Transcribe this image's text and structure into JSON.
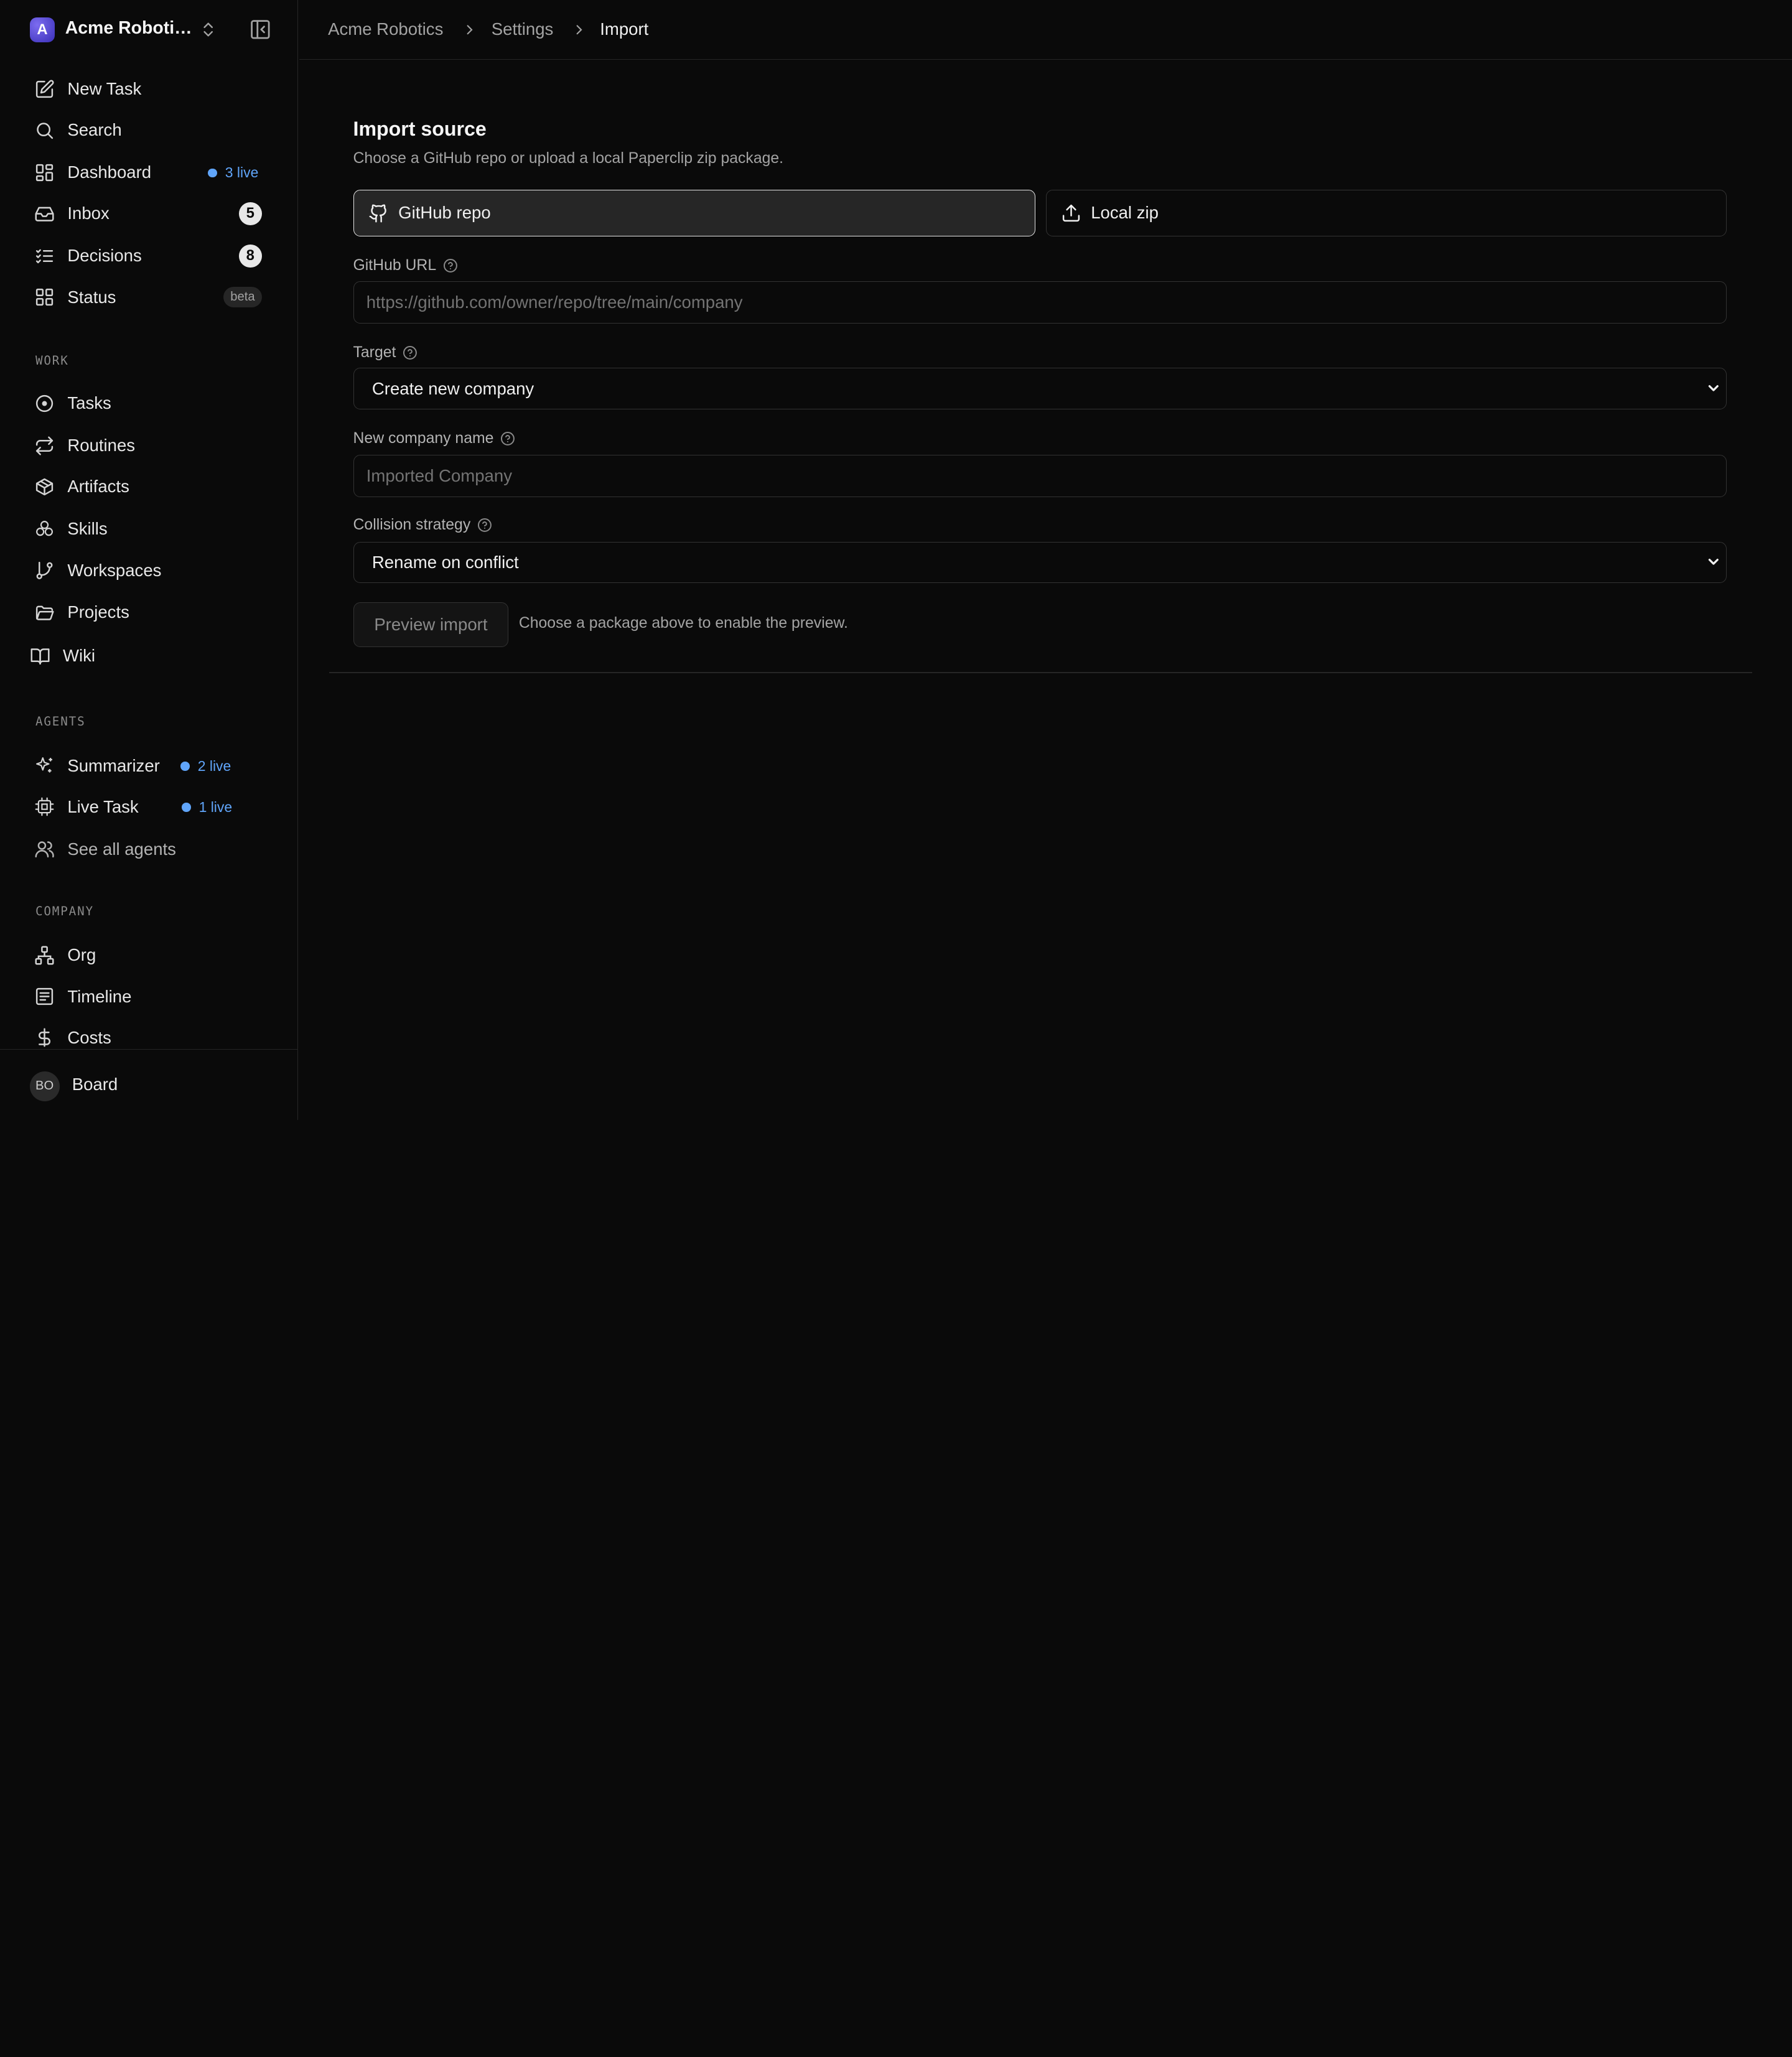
{
  "sidebar": {
    "company": {
      "initial": "A",
      "name": "Acme Robotics"
    },
    "primary": [
      {
        "label": "New Task"
      },
      {
        "label": "Search"
      },
      {
        "label": "Dashboard",
        "live": "3 live"
      },
      {
        "label": "Inbox",
        "count": "5"
      },
      {
        "label": "Decisions",
        "count": "8"
      },
      {
        "label": "Status",
        "badge": "beta"
      }
    ],
    "work": {
      "title": "WORK",
      "items": [
        {
          "label": "Tasks"
        },
        {
          "label": "Routines"
        },
        {
          "label": "Artifacts"
        },
        {
          "label": "Skills"
        },
        {
          "label": "Workspaces"
        },
        {
          "label": "Projects"
        },
        {
          "label": "Wiki"
        }
      ]
    },
    "agents": {
      "title": "AGENTS",
      "items": [
        {
          "label": "Summarizer",
          "live": "2 live"
        },
        {
          "label": "Live Task",
          "live": "1 live"
        },
        {
          "label": "See all agents"
        }
      ]
    },
    "company_section": {
      "title": "COMPANY",
      "items": [
        {
          "label": "Org"
        },
        {
          "label": "Timeline"
        },
        {
          "label": "Costs"
        }
      ]
    },
    "user": {
      "initials": "BO",
      "name": "Board"
    }
  },
  "breadcrumb": [
    "Acme Robotics",
    "Settings",
    "Import"
  ],
  "import": {
    "title": "Import source",
    "subtitle": "Choose a GitHub repo or upload a local Paperclip zip package.",
    "sources": [
      {
        "label": "GitHub repo",
        "icon": "github-icon",
        "active": true
      },
      {
        "label": "Local zip",
        "icon": "upload-icon",
        "active": false
      }
    ],
    "github_url": {
      "label": "GitHub URL",
      "value": "",
      "placeholder": "https://github.com/owner/repo/tree/main/company"
    },
    "target": {
      "label": "Target",
      "selected": "Create new company"
    },
    "company_name": {
      "label": "New company name",
      "value": "",
      "placeholder": "Imported Company"
    },
    "collision": {
      "label": "Collision strategy",
      "selected": "Rename on conflict"
    },
    "preview_button": "Preview import",
    "preview_hint": "Choose a package above to enable the preview."
  },
  "colors": {
    "accent_live": "#60a5fa",
    "background": "#0a0a0a",
    "border": "#262626"
  }
}
